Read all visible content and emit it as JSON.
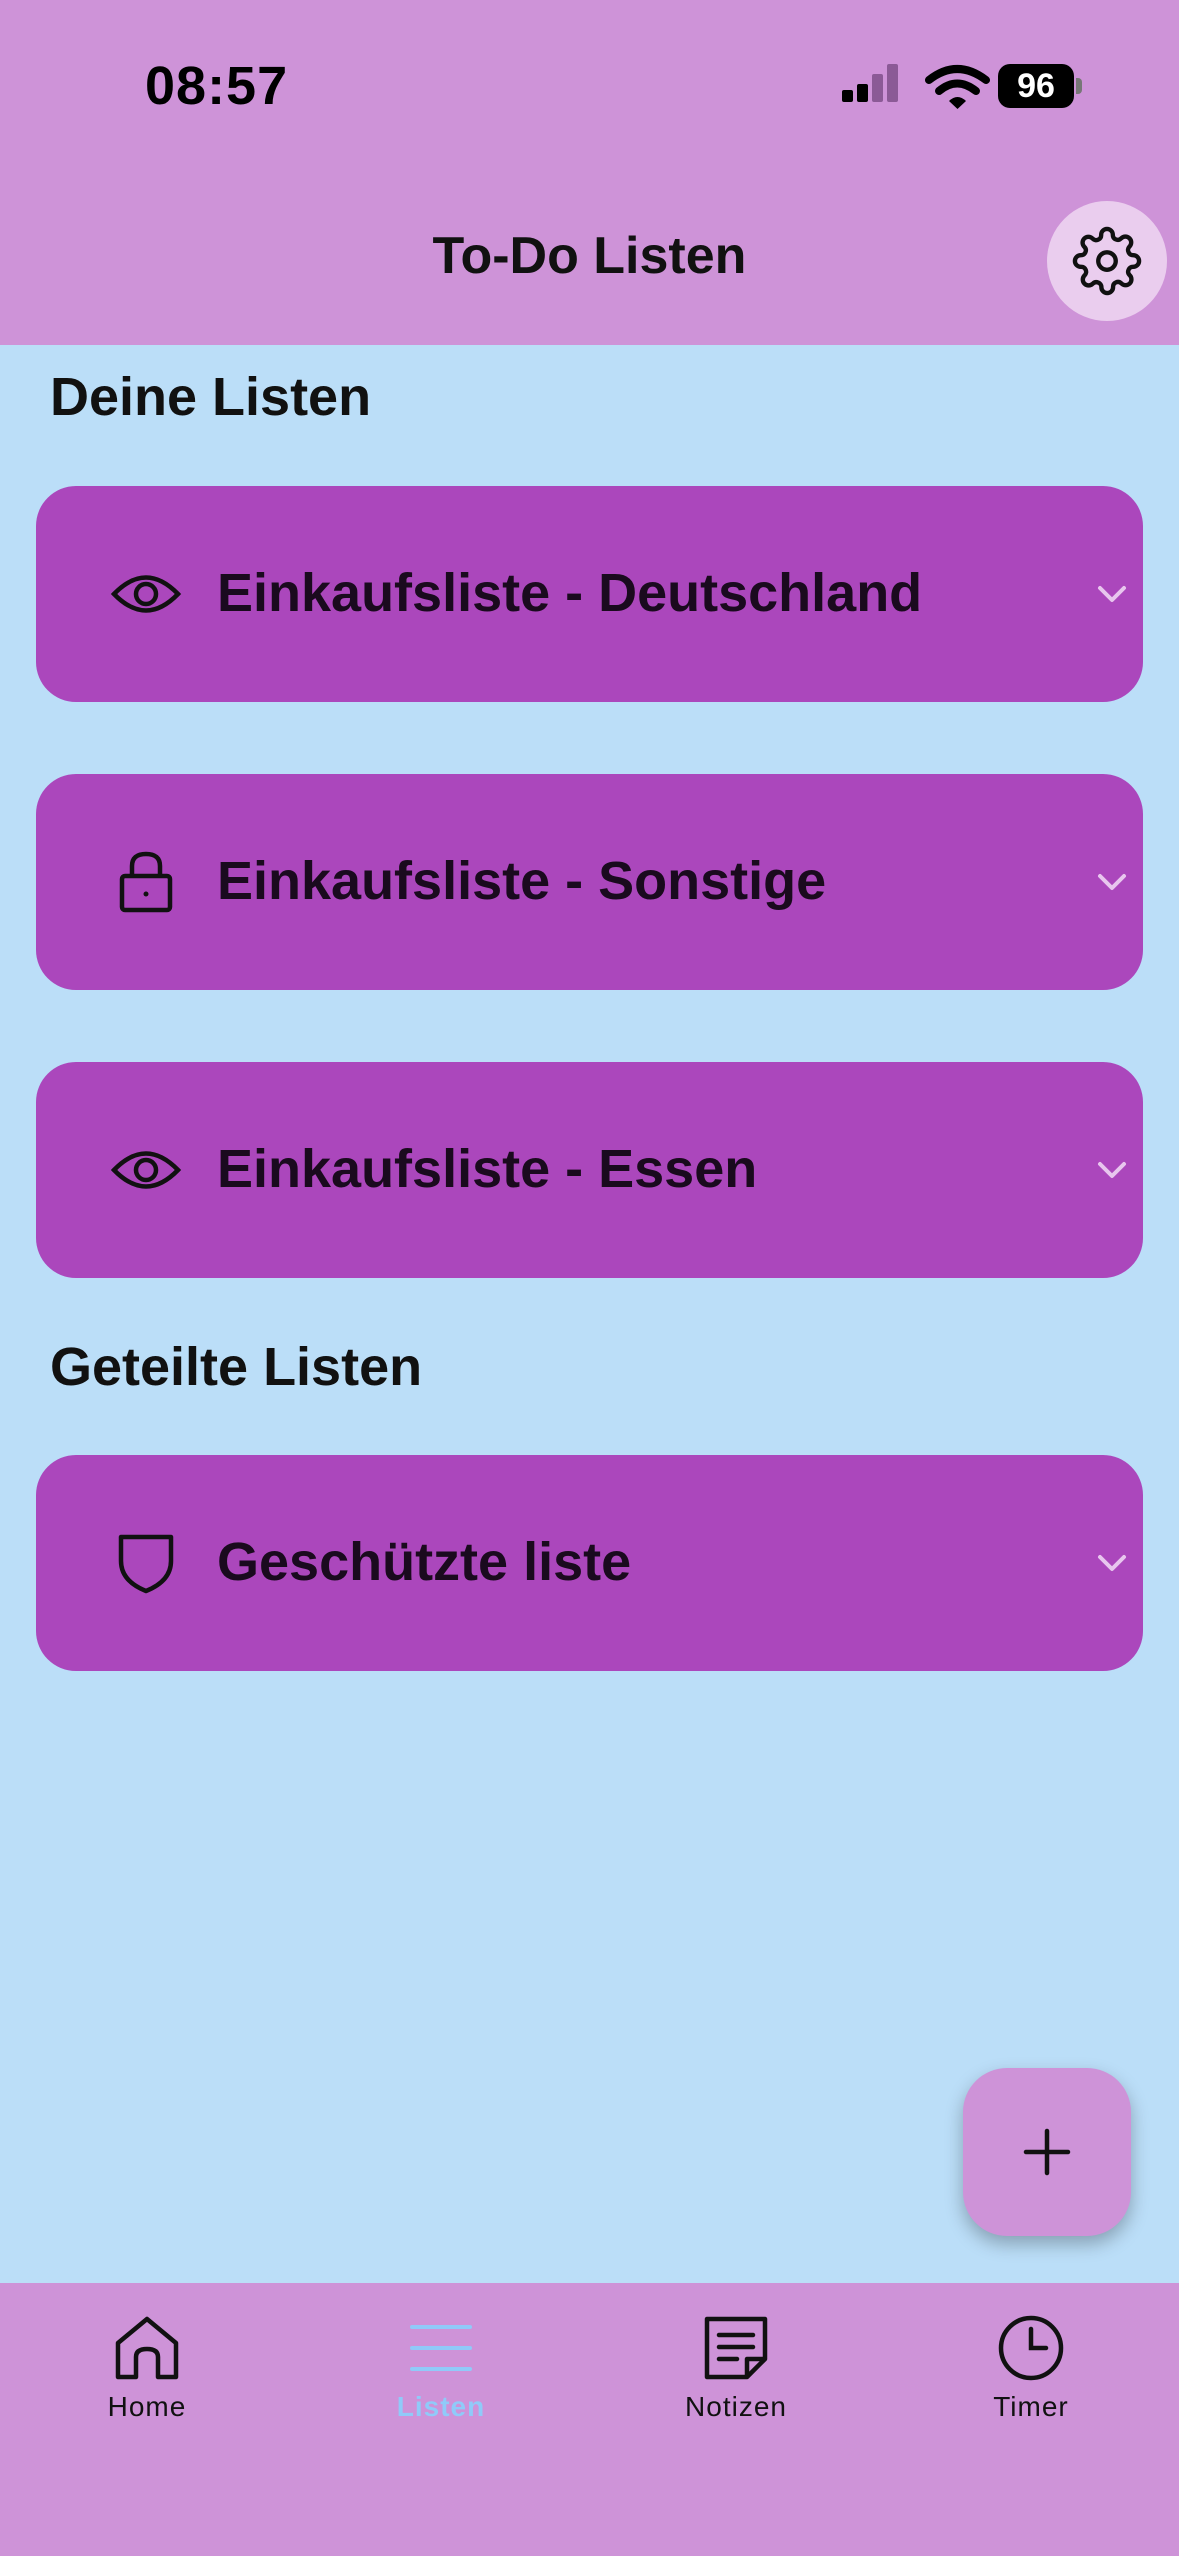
{
  "status_bar": {
    "time": "08:57",
    "battery": "96"
  },
  "header": {
    "title": "To-Do Listen",
    "settings_icon": "gear-icon"
  },
  "sections": [
    {
      "title": "Deine Listen",
      "lists": [
        {
          "label": "Einkaufsliste - Deutschland",
          "icon": "eye-icon"
        },
        {
          "label": "Einkaufsliste - Sonstige",
          "icon": "lock-icon"
        },
        {
          "label": "Einkaufsliste - Essen",
          "icon": "eye-icon"
        }
      ]
    },
    {
      "title": "Geteilte Listen",
      "lists": [
        {
          "label": "Geschützte liste",
          "icon": "shield-icon"
        }
      ]
    }
  ],
  "fab": {
    "icon": "plus-icon"
  },
  "bottom_nav": {
    "items": [
      {
        "label": "Home",
        "icon": "home-icon",
        "active": false
      },
      {
        "label": "Listen",
        "icon": "list-icon",
        "active": true
      },
      {
        "label": "Notizen",
        "icon": "note-icon",
        "active": false
      },
      {
        "label": "Timer",
        "icon": "clock-icon",
        "active": false
      }
    ]
  },
  "colors": {
    "header_bg": "#CE93D8",
    "page_bg": "#BBDEF8",
    "card_bg": "#AB47BC",
    "nav_active": "#90CAF9"
  }
}
